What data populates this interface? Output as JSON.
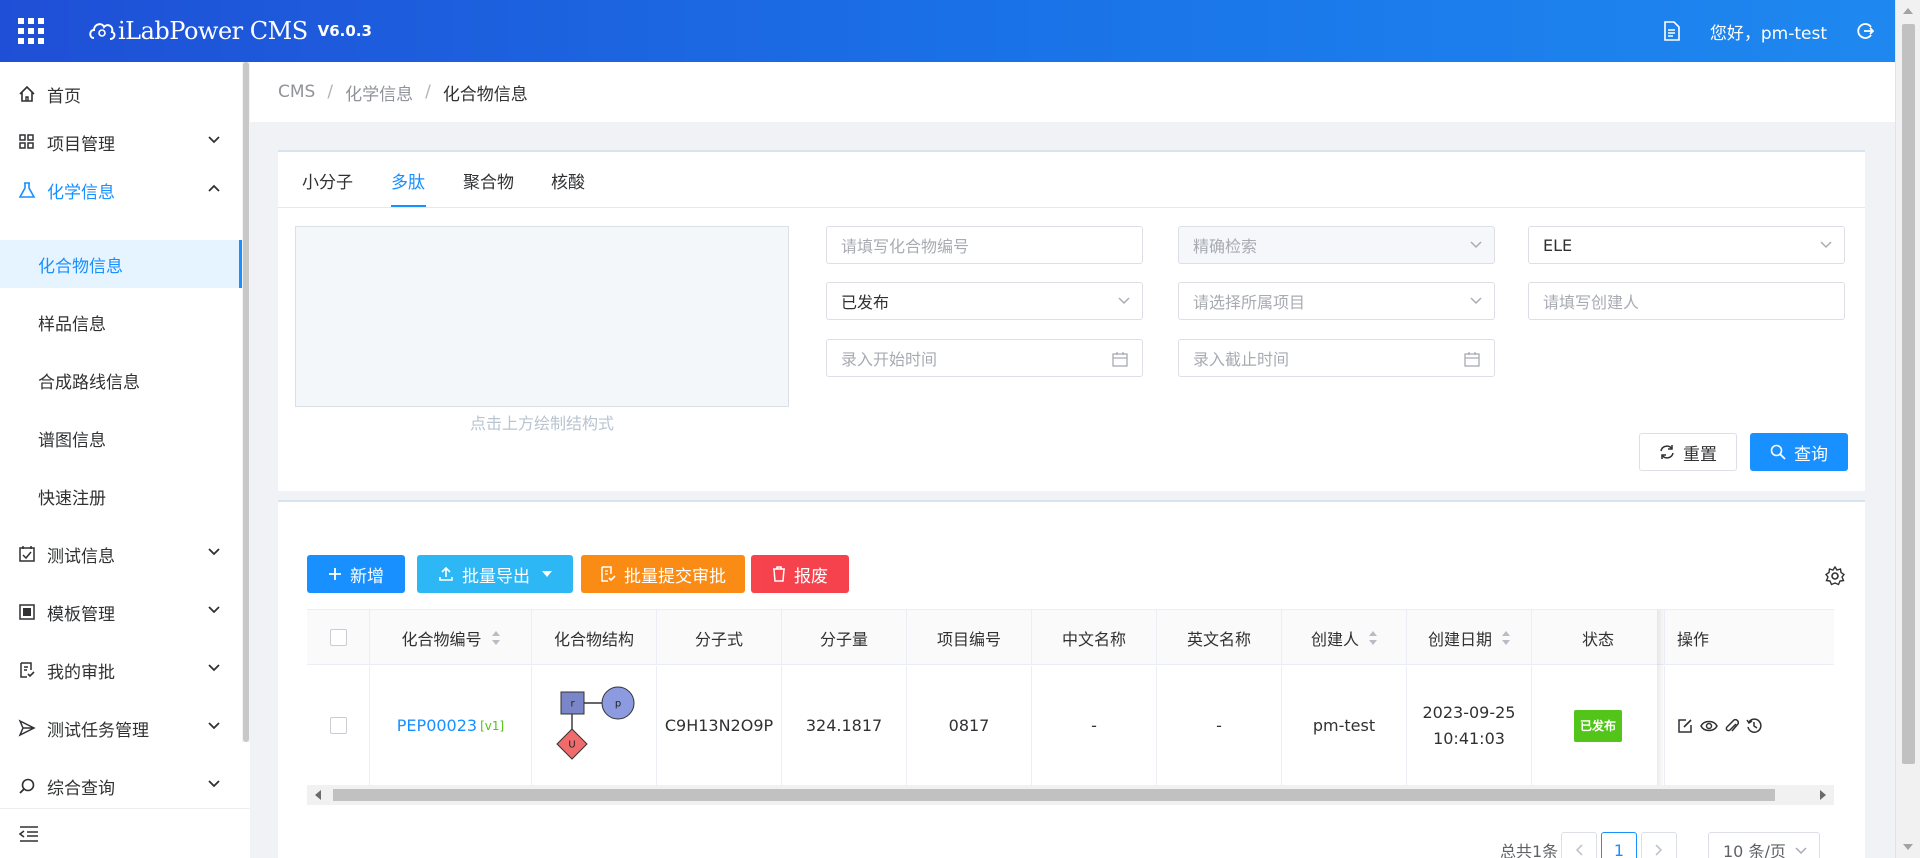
{
  "header": {
    "logo_name": "iLabPower CMS",
    "version": "V6.0.3",
    "greeting": "您好，pm-test",
    "accent": "#1a73e8"
  },
  "sidebar": {
    "items": [
      {
        "label": "首页",
        "icon": "home-icon"
      },
      {
        "label": "项目管理",
        "icon": "grid-icon"
      },
      {
        "label": "化学信息",
        "icon": "flask-icon"
      },
      {
        "label": "测试信息",
        "icon": "checkbox-calendar-icon"
      },
      {
        "label": "模板管理",
        "icon": "template-icon"
      },
      {
        "label": "我的审批",
        "icon": "approval-icon"
      },
      {
        "label": "测试任务管理",
        "icon": "send-icon"
      },
      {
        "label": "综合查询",
        "icon": "search-icon"
      }
    ],
    "sub_items": [
      "化合物信息",
      "样品信息",
      "合成路线信息",
      "谱图信息",
      "快速注册"
    ]
  },
  "breadcrumb": {
    "root": "CMS",
    "parent": "化学信息",
    "current": "化合物信息"
  },
  "search": {
    "tabs": [
      "小分子",
      "多肽",
      "聚合物",
      "核酸"
    ],
    "active_tab": "多肽",
    "draw_hint": "点击上方绘制结构式",
    "compound_no_placeholder": "请填写化合物编号",
    "match_mode": "精确检索",
    "element_value": "ELE",
    "status_value": "已发布",
    "project_placeholder": "请选择所属项目",
    "creator_placeholder": "请填写创建人",
    "start_time_placeholder": "录入开始时间",
    "end_time_placeholder": "录入截止时间",
    "reset_label": "重置",
    "query_label": "查询"
  },
  "toolbar": {
    "add_label": "新增",
    "export_label": "批量导出",
    "submit_label": "批量提交审批",
    "discard_label": "报废",
    "colors": {
      "add": "#1890ff",
      "export": "#2db7f5",
      "submit": "#fa8c16",
      "discard": "#f5222d"
    }
  },
  "table": {
    "columns": [
      "化合物编号",
      "化合物结构",
      "分子式",
      "分子量",
      "项目编号",
      "中文名称",
      "英文名称",
      "创建人",
      "创建日期",
      "状态",
      "操作"
    ],
    "rows": [
      {
        "compound_no": "PEP00023",
        "version": "[v1]",
        "structure_nodes": [
          "r",
          "p",
          "U"
        ],
        "formula": "C9H13N2O9P",
        "mw": "324.1817",
        "project": "0817",
        "cn_name": "-",
        "en_name": "-",
        "creator": "pm-test",
        "date": "2023-09-25",
        "time": "10:41:03",
        "status": "已发布"
      }
    ]
  },
  "pagination": {
    "total": "总共1条",
    "current_page": "1",
    "page_size": "10 条/页"
  }
}
